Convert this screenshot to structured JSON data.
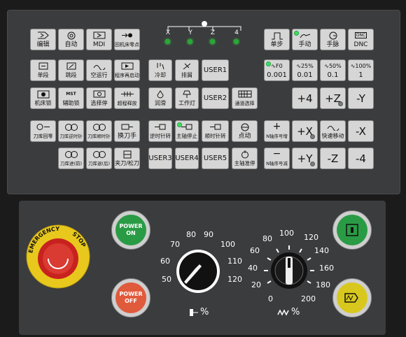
{
  "indicators": {
    "labels": [
      "X",
      "Y",
      "Z",
      "4"
    ]
  },
  "mode_buttons": [
    "编辑",
    "自动",
    "MDI",
    "回机床零点",
    "单段",
    "跳段",
    "空运行",
    "程序再启动",
    "机床锁",
    "辅助锁",
    "选择停",
    "超程释放",
    "刀库回零",
    "刀库逆时针",
    "刀库顺时针",
    "换刀手",
    "刀库进(前)",
    "刀库退(后)",
    "夹刀/松刀"
  ],
  "aux_buttons": [
    "冷却",
    "排屑",
    "USER1",
    "润滑",
    "工作灯",
    "USER2",
    "通道选择",
    "逆时针转",
    "主轴停止",
    "顺时针转",
    "点动",
    "USER3",
    "USER4",
    "USER5",
    "主轴准停"
  ],
  "jog_buttons": [
    "单步",
    "手动",
    "手脉",
    "DNC"
  ],
  "dnc_icon_text": "DNC",
  "rapid_override": {
    "pct": [
      "F0",
      "25%",
      "50%",
      "100%"
    ],
    "values": [
      "0.001",
      "0.01",
      "0.1",
      "1"
    ]
  },
  "axis_buttons": [
    "+4",
    "+Z",
    "-Y",
    "+X",
    "快速移动",
    "-X",
    "+Y",
    "-Z",
    "-4"
  ],
  "spindle_override_buttons": [
    "+",
    "N轴序号增",
    "−",
    "N轴序号减"
  ],
  "bottom": {
    "emergency_top": "EMERGENCY",
    "emergency_bottom": "STOP",
    "power_on": [
      "POWER",
      "ON"
    ],
    "power_off": [
      "POWER",
      "OFF"
    ],
    "spindle_dial": {
      "ticks": [
        "50",
        "60",
        "70",
        "80",
        "90",
        "100",
        "110",
        "120"
      ],
      "label": "%"
    },
    "feed_dial": {
      "ticks": [
        "0",
        "20",
        "40",
        "60",
        "80",
        "100",
        "120",
        "140",
        "160",
        "180",
        "200"
      ],
      "label": "%"
    }
  },
  "colors": {
    "panel": "#3b3c3e",
    "button": "#d6d6d6",
    "led_on": "#3fe060",
    "green_btn": "#2a9b45",
    "red_btn": "#e05a3c",
    "yellow_btn": "#d8c81e"
  }
}
